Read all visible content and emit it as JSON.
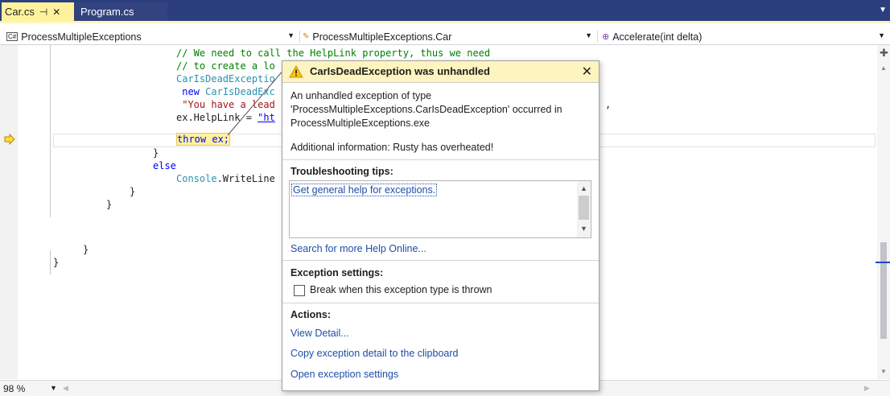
{
  "tabs": [
    {
      "label": "Car.cs",
      "active": true,
      "pin": "⊣",
      "close": "✕"
    },
    {
      "label": "Program.cs",
      "active": false
    }
  ],
  "navbar": {
    "project": "ProcessMultipleExceptions",
    "type": "ProcessMultipleExceptions.Car",
    "member": "Accelerate(int delta)"
  },
  "code": {
    "l1_comment": "// We need to call the HelpLink property, thus we need",
    "l2_comment": "// to create a lo",
    "l3_type": "CarIsDeadExceptio",
    "l4_kw": "new",
    "l4_type": "CarIsDeadExc",
    "l5_str": "\"You have a lead",
    "l6_ident": "ex.HelpLink = ",
    "l6_str": "\"ht",
    "l7_throw": "throw ex;",
    "brace1": "}",
    "else_kw": "else",
    "console": "Console",
    "writeline": ".WriteLine",
    "brace2": "}",
    "brace3": "}",
    "brace4": "}",
    "brace5": "}",
    "trailing_comma": ","
  },
  "popup": {
    "title": "CarIsDeadException was unhandled",
    "message": "An unhandled exception of type 'ProcessMultipleExceptions.CarIsDeadException' occurred in ProcessMultipleExceptions.exe",
    "additional": "Additional information: Rusty has overheated!",
    "tips_header": "Troubleshooting tips:",
    "tip_link": "Get general help for exceptions.",
    "search_link": "Search for more Help Online...",
    "settings_header": "Exception settings:",
    "break_label": "Break when this exception type is thrown",
    "break_checked": false,
    "actions_header": "Actions:",
    "view_detail": "View Detail...",
    "copy_detail": "Copy exception detail to the clipboard",
    "open_settings": "Open exception settings"
  },
  "statusbar": {
    "zoom": "98 %"
  },
  "colors": {
    "tabbar": "#2b3f7f",
    "active_tab": "#fff29d",
    "popup_header": "#fdf4bf",
    "link": "#1f4ea6"
  }
}
